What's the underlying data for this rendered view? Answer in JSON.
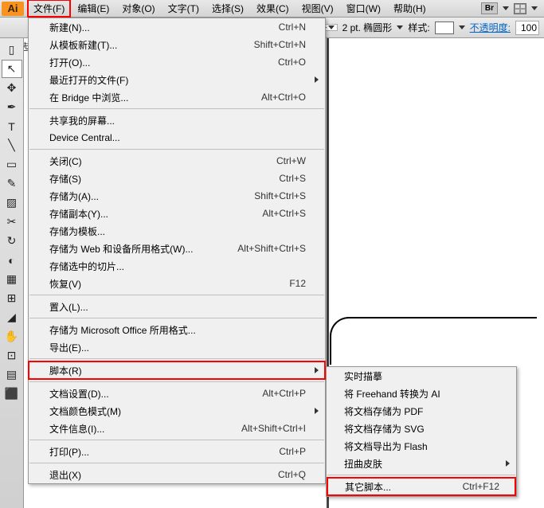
{
  "app_icon": "Ai",
  "menubar": {
    "items": [
      {
        "label": "文件(F)",
        "active": true
      },
      {
        "label": "编辑(E)"
      },
      {
        "label": "对象(O)"
      },
      {
        "label": "文字(T)"
      },
      {
        "label": "选择(S)"
      },
      {
        "label": "效果(C)"
      },
      {
        "label": "视图(V)"
      },
      {
        "label": "窗口(W)"
      },
      {
        "label": "帮助(H)"
      }
    ],
    "br_badge": "Br"
  },
  "optbar": {
    "untitled": "未选",
    "stroke_pt": "2 pt. 椭圆形",
    "style_label": "样式:",
    "opacity_label": "不透明度:",
    "opacity_value": "100"
  },
  "file_menu": [
    {
      "label": "新建(N)...",
      "shortcut": "Ctrl+N"
    },
    {
      "label": "从模板新建(T)...",
      "shortcut": "Shift+Ctrl+N"
    },
    {
      "label": "打开(O)...",
      "shortcut": "Ctrl+O"
    },
    {
      "label": "最近打开的文件(F)",
      "submenu": true
    },
    {
      "label": "在 Bridge 中浏览...",
      "shortcut": "Alt+Ctrl+O"
    },
    {
      "sep": true
    },
    {
      "label": "共享我的屏幕..."
    },
    {
      "label": "Device Central..."
    },
    {
      "sep": true
    },
    {
      "label": "关闭(C)",
      "shortcut": "Ctrl+W"
    },
    {
      "label": "存储(S)",
      "shortcut": "Ctrl+S"
    },
    {
      "label": "存储为(A)...",
      "shortcut": "Shift+Ctrl+S"
    },
    {
      "label": "存储副本(Y)...",
      "shortcut": "Alt+Ctrl+S"
    },
    {
      "label": "存储为模板..."
    },
    {
      "label": "存储为 Web 和设备所用格式(W)...",
      "shortcut": "Alt+Shift+Ctrl+S"
    },
    {
      "label": "存储选中的切片..."
    },
    {
      "label": "恢复(V)",
      "shortcut": "F12"
    },
    {
      "sep": true
    },
    {
      "label": "置入(L)..."
    },
    {
      "sep": true
    },
    {
      "label": "存储为 Microsoft Office 所用格式..."
    },
    {
      "label": "导出(E)..."
    },
    {
      "sep": true
    },
    {
      "label": "脚本(R)",
      "submenu": true,
      "hl": true
    },
    {
      "sep": true
    },
    {
      "label": "文档设置(D)...",
      "shortcut": "Alt+Ctrl+P"
    },
    {
      "label": "文档颜色模式(M)",
      "submenu": true
    },
    {
      "label": "文件信息(I)...",
      "shortcut": "Alt+Shift+Ctrl+I"
    },
    {
      "sep": true
    },
    {
      "label": "打印(P)...",
      "shortcut": "Ctrl+P"
    },
    {
      "sep": true
    },
    {
      "label": "退出(X)",
      "shortcut": "Ctrl+Q"
    }
  ],
  "scripts_submenu": [
    {
      "label": "实时描摹"
    },
    {
      "label": "将 Freehand 转换为 AI"
    },
    {
      "label": "将文档存储为 PDF"
    },
    {
      "label": "将文档存储为 SVG"
    },
    {
      "label": "将文档导出为 Flash"
    },
    {
      "label": "扭曲皮肤",
      "submenu": true
    },
    {
      "sep": true
    },
    {
      "label": "其它脚本...",
      "shortcut": "Ctrl+F12",
      "hl": true
    }
  ],
  "tools": [
    "▯",
    "↖",
    "✥",
    "✒",
    "T",
    "╲",
    "▭",
    "✎",
    "▨",
    "✂",
    "↻",
    "◐",
    "▦",
    "⊞",
    "◢",
    "✋",
    "⊡",
    "▤",
    "⬛"
  ]
}
